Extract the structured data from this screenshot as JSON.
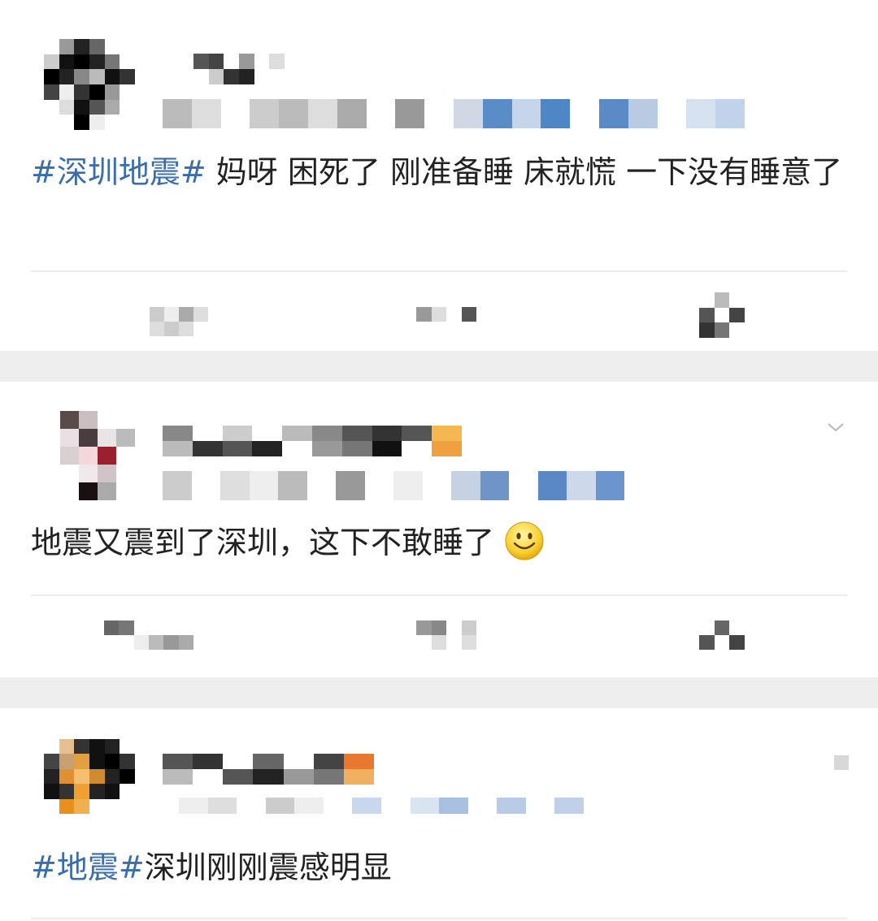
{
  "posts": [
    {
      "topic": "#深圳地震#",
      "body": " 妈呀 困死了 刚准备睡 床就慌 一下没有睡意了",
      "has_emoji": false
    },
    {
      "topic": "",
      "body": "地震又震到了深圳，这下不敢睡了",
      "has_emoji": true,
      "emoji": "smiley-face"
    },
    {
      "topic": "#地震#",
      "body": "深圳刚刚震感明显",
      "has_emoji": false
    }
  ],
  "colors": {
    "topic": "#3b6ea8",
    "text": "#222222",
    "background": "#ffffff",
    "separator": "#eeeeee"
  },
  "icons": [
    "blurred-avatar",
    "blurred-username",
    "blurred-metadata",
    "share-action",
    "comment-action",
    "like-action",
    "dropdown-chevron-icon"
  ]
}
